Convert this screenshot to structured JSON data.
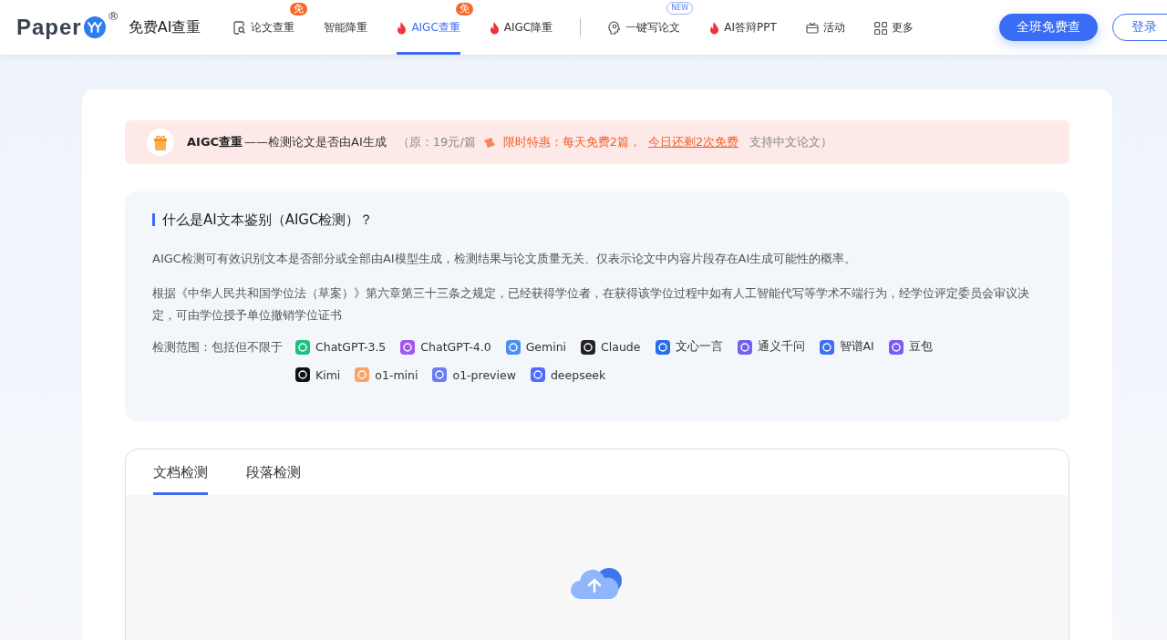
{
  "header": {
    "brand": "Paper",
    "brand_mark": "®",
    "tagline": "免费AI查重",
    "nav": [
      {
        "label": "论文查重",
        "kind": "search",
        "badge": "免",
        "selected": false
      },
      {
        "label": "智能降重",
        "kind": "plain",
        "selected": false
      },
      {
        "label": "AIGC查重",
        "kind": "fire",
        "badge": "免",
        "selected": true
      },
      {
        "label": "AIGC降重",
        "kind": "fire",
        "selected": false
      },
      {
        "label": "一键写论文",
        "kind": "bulb",
        "badge": "NEW",
        "selected": false
      },
      {
        "label": "AI答辩PPT",
        "kind": "fire",
        "selected": false
      },
      {
        "label": "活动",
        "kind": "gift",
        "selected": false
      },
      {
        "label": "更多",
        "kind": "grid",
        "selected": false
      }
    ],
    "primary_button": "全班免费查",
    "login_button": "登录"
  },
  "banner": {
    "title": "AIGC查重",
    "subtitle": "——检测论文是否由AI生成",
    "price": "（原：19元/篇",
    "promo": "限时特惠：每天免费2篇，",
    "promo_link": "今日还剩2次免费",
    "note": "支持中文论文）"
  },
  "info": {
    "heading": "什么是AI文本鉴别（AIGC检测）？",
    "paragraphs": [
      "AIGC检测可有效识别文本是否部分或全部由AI模型生成，检测结果与论文质量无关、仅表示论文中内容片段存在AI生成可能性的概率。",
      "根据《中华人民共和国学位法（草案）》第六章第三十三条之规定，已经获得学位者，在获得该学位过程中如有人工智能代写等学术不端行为，经学位评定委员会审议决定，可由学位授予单位撤销学位证书"
    ],
    "scope_label": "检测范围：包括但不限于",
    "models": [
      {
        "name": "ChatGPT-3.5",
        "color": "#19c37d"
      },
      {
        "name": "ChatGPT-4.0",
        "color": "#a259f0"
      },
      {
        "name": "Gemini",
        "color": "#4b8ef5"
      },
      {
        "name": "Claude",
        "color": "#222222"
      },
      {
        "name": "文心一言",
        "color": "#2a6cf0"
      },
      {
        "name": "通义千问",
        "color": "#7061f0"
      },
      {
        "name": "智谱AI",
        "color": "#3d6ff0"
      },
      {
        "name": "豆包",
        "color": "#7b5cf5"
      },
      {
        "name": "Kimi",
        "color": "#111111"
      },
      {
        "name": "o1-mini",
        "color": "#f7a46b"
      },
      {
        "name": "o1-preview",
        "color": "#6b7cf5"
      },
      {
        "name": "deepseek",
        "color": "#4d6bfe"
      }
    ]
  },
  "upload": {
    "tabs": [
      {
        "label": "文档检测",
        "selected": true
      },
      {
        "label": "段落检测",
        "selected": false
      }
    ]
  }
}
